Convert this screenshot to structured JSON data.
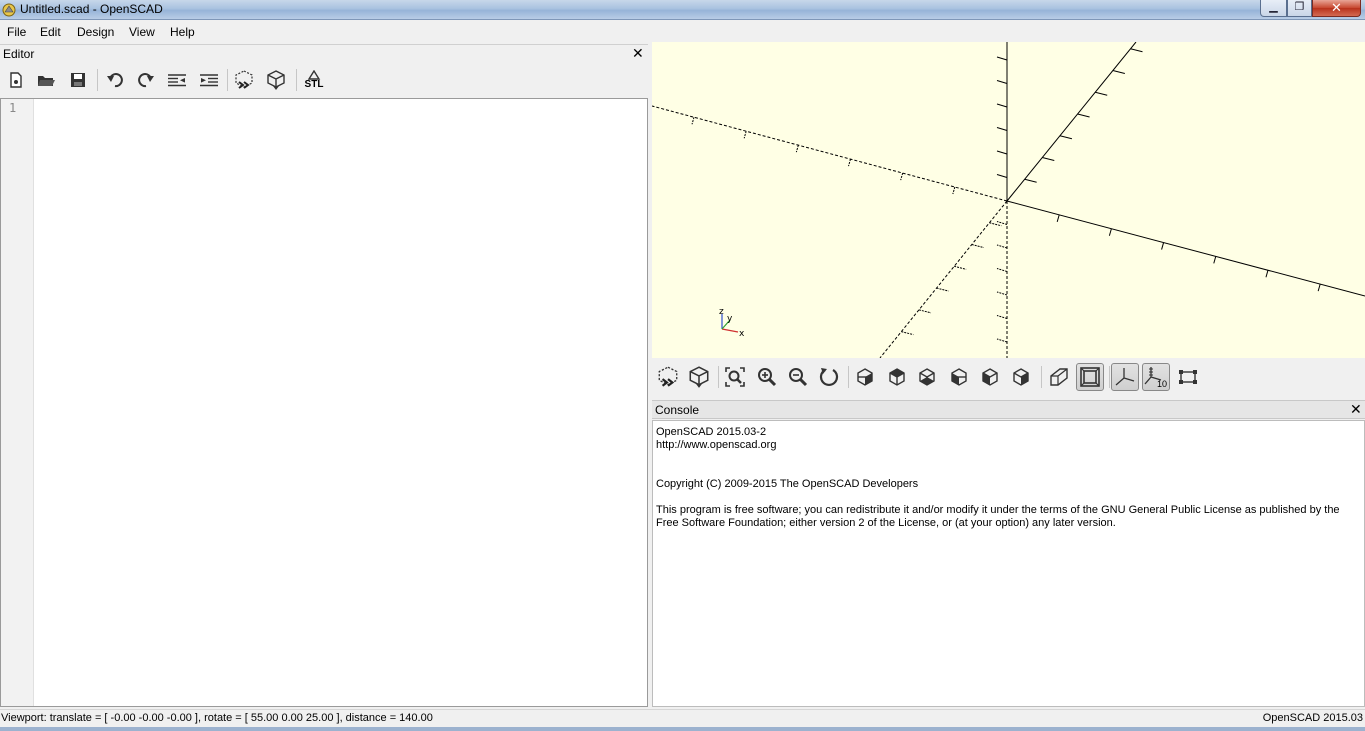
{
  "window": {
    "title": "Untitled.scad - OpenSCAD",
    "min_glyph": "▁",
    "max_glyph": "❐",
    "close_glyph": "✕"
  },
  "menu": [
    "File",
    "Edit",
    "Design",
    "View",
    "Help"
  ],
  "editor": {
    "title": "Editor",
    "close_glyph": "✕",
    "line_numbers": [
      "1"
    ],
    "toolbar": [
      {
        "name": "new-file-icon"
      },
      {
        "name": "open-file-icon"
      },
      {
        "name": "save-file-icon"
      },
      {
        "name": "undo-icon"
      },
      {
        "name": "redo-icon"
      },
      {
        "name": "unindent-icon"
      },
      {
        "name": "indent-icon"
      },
      {
        "name": "preview-icon"
      },
      {
        "name": "render-icon"
      },
      {
        "name": "export-stl-icon",
        "label": "STL"
      }
    ]
  },
  "viewport": {
    "background": "#ffffe5",
    "axis_labels": {
      "x": "x",
      "y": "y",
      "z": "z"
    }
  },
  "view_toolbar": [
    {
      "name": "preview-icon"
    },
    {
      "name": "render-icon"
    },
    {
      "name": "view-all-icon"
    },
    {
      "name": "zoom-in-icon"
    },
    {
      "name": "zoom-out-icon"
    },
    {
      "name": "reset-view-icon"
    },
    {
      "name": "view-right-icon"
    },
    {
      "name": "view-top-icon"
    },
    {
      "name": "view-bottom-icon"
    },
    {
      "name": "view-left-icon"
    },
    {
      "name": "view-front-icon"
    },
    {
      "name": "view-back-icon"
    },
    {
      "name": "perspective-icon"
    },
    {
      "name": "orthogonal-icon",
      "active": true
    },
    {
      "name": "show-axes-icon",
      "active": true
    },
    {
      "name": "show-scale-markers-icon",
      "active": true,
      "label": "10"
    },
    {
      "name": "show-edges-icon"
    }
  ],
  "console": {
    "title": "Console",
    "close_glyph": "✕",
    "lines": [
      "OpenSCAD 2015.03-2",
      "http://www.openscad.org",
      "",
      "",
      "Copyright (C) 2009-2015 The OpenSCAD Developers",
      "",
      "This program is free software; you can redistribute it and/or modify it under the terms of the GNU General Public License as published by the Free Software Foundation; either version 2 of the License, or (at your option) any later version."
    ]
  },
  "status": {
    "viewport_info": "Viewport: translate = [ -0.00 -0.00 -0.00 ], rotate = [ 55.00 0.00 25.00 ], distance = 140.00",
    "version": "OpenSCAD 2015.03"
  }
}
